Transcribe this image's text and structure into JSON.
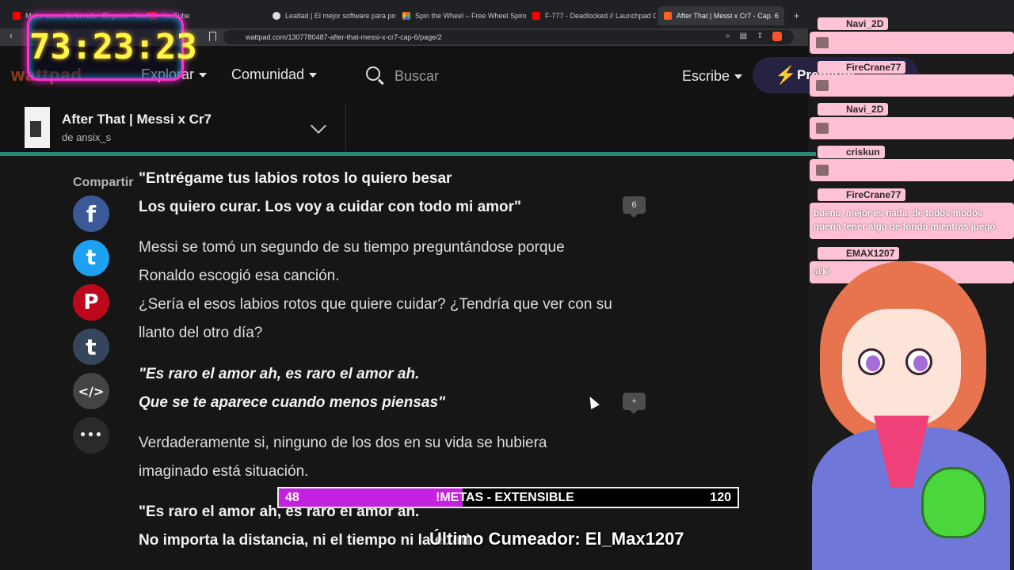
{
  "browser": {
    "tabs": [
      {
        "label": "Mujer casos de la vida - El genio - YouTube",
        "color": "#ff0000"
      },
      {
        "label": "YouTube",
        "color": "#ff0000"
      },
      {
        "label": "Lealtad | El mejor software para pote",
        "color": "#ffffff"
      },
      {
        "label": "Spin the Wheel – Free Wheel Spinner",
        "color": "#4caf50"
      },
      {
        "label": "F-777 - Deadlocked // Launchpad Co",
        "color": "#ff0000"
      },
      {
        "label": "After That | Messi x Cr7 - Cap. 6",
        "color": "#ff6122"
      }
    ],
    "url": "wattpad.com/1307780487-after-that-messi-x-cr7-cap-6/page/2"
  },
  "header": {
    "logo": "wattpad",
    "explore": "Explorar",
    "community": "Comunidad",
    "search_placeholder": "Buscar",
    "write": "Escribe",
    "premium": "Premium"
  },
  "story": {
    "title": "After That | Messi x Cr7",
    "author": "de ansix_s"
  },
  "share": {
    "label": "Compartir",
    "buttons": [
      {
        "name": "facebook",
        "glyph": "f",
        "color": "#3b5998"
      },
      {
        "name": "twitter",
        "glyph": "t",
        "color": "#1da1f2"
      },
      {
        "name": "pinterest",
        "glyph": "P",
        "color": "#bd081c"
      },
      {
        "name": "tumblr",
        "glyph": "t",
        "color": "#35465c"
      },
      {
        "name": "embed",
        "glyph": "</>",
        "color": "#444444"
      },
      {
        "name": "more",
        "glyph": "•••",
        "color": "#2a2a2a"
      }
    ]
  },
  "content": {
    "p1_line1": "\"Entrégame tus labios rotos lo quiero besar",
    "p1_line2": "Los quiero curar. Los voy a cuidar con todo mi amor\"",
    "comment_count_1": "6",
    "p2_line1": "Messi se tomó un segundo de su tiempo preguntándose porque",
    "p2_line2": "Ronaldo escogió esa canción.",
    "p2_line3": "¿Sería el esos labios rotos que quiere cuidar? ¿Tendría que ver con su",
    "p2_line4": "llanto del otro día?",
    "p3_line1": "\"Es raro el amor ah, es raro el amor ah.",
    "p3_line2": "Que se te aparece cuando menos piensas\"",
    "comment_count_2": "+",
    "p4_line1": "Verdaderamente si, ninguno de los dos en su vida se hubiera",
    "p4_line2": "imaginado está situación.",
    "p5_line1": "\"Es raro el amor ah, es raro el amor ah.",
    "p5_line2": "No importa la distancia, ni el tiempo ni la edad"
  },
  "overlay": {
    "timer": "73:23:23",
    "goal_current": "48",
    "goal_label": "!METAS - EXTENSIBLE",
    "goal_target": "120",
    "goal_fraction": 0.4,
    "last_cum": "Último Cumeador: El_Max1207"
  },
  "chat": {
    "messages": [
      {
        "user": "Navi_2D",
        "text": ""
      },
      {
        "user": "FireCrane77",
        "text": ""
      },
      {
        "user": "Navi_2D",
        "text": ""
      },
      {
        "user": "criskun",
        "text": ""
      },
      {
        "user": "FireCrane77",
        "text": "bueno, mejor es nada, de todos modos queria tener algo de fondo mientras juego"
      },
      {
        "user": "EMAX1207",
        "text": "@ki"
      }
    ]
  }
}
